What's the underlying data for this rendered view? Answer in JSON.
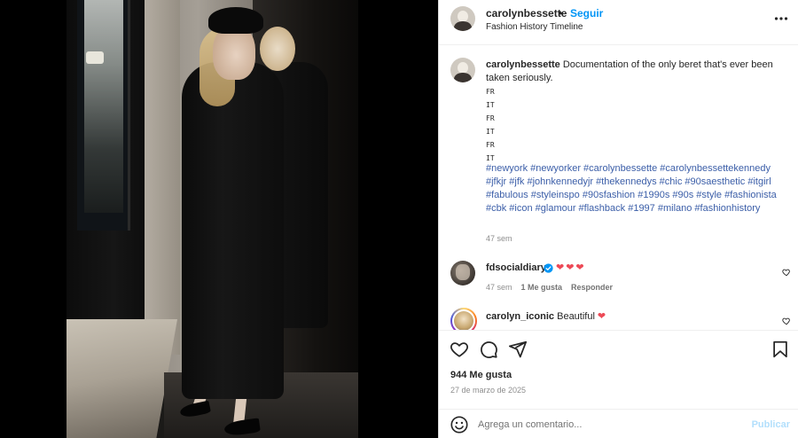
{
  "header": {
    "username": "carolynbessette",
    "dot": "•",
    "follow_label": "Seguir",
    "subtitle": "Fashion History Timeline"
  },
  "caption": {
    "username": "carolynbessette",
    "text": "Documentation of the only beret that's ever been taken seriously.",
    "lines": [
      "FR",
      "IT",
      "FR",
      "IT",
      "FR",
      "IT"
    ],
    "hashtags": "#newyork #newyorker #carolynbessette #carolynbessettekennedy #jfkjr #jfk #johnkennedyjr #thekennedys #chic #90saesthetic #itgirl #fabulous #styleinspo #90sfashion #1990s #90s #style #fashionista #cbk #icon #glamour #flashback #1997 #milano #fashionhistory",
    "time": "47 sem"
  },
  "comments": [
    {
      "username": "fdsocialdiary",
      "hearts": "❤❤❤",
      "time": "47 sem",
      "likes": "1 Me gusta",
      "reply_label": "Responder"
    },
    {
      "username": "carolyn_iconic",
      "text": "Beautiful",
      "heart": "❤"
    }
  ],
  "actions": {
    "likes": "944 Me gusta",
    "date": "27 de marzo de 2025"
  },
  "add_comment": {
    "placeholder": "Agrega un comentario...",
    "publish_label": "Publicar"
  },
  "colors": {
    "link_blue": "#0095f6",
    "hashtag_blue": "#3b5ea8",
    "heart_red": "#ed4956",
    "muted": "#8e8e8e"
  },
  "icons": [
    "more-icon",
    "verified-icon",
    "heart-icon",
    "comment-icon",
    "share-icon",
    "bookmark-icon",
    "emoji-icon"
  ]
}
